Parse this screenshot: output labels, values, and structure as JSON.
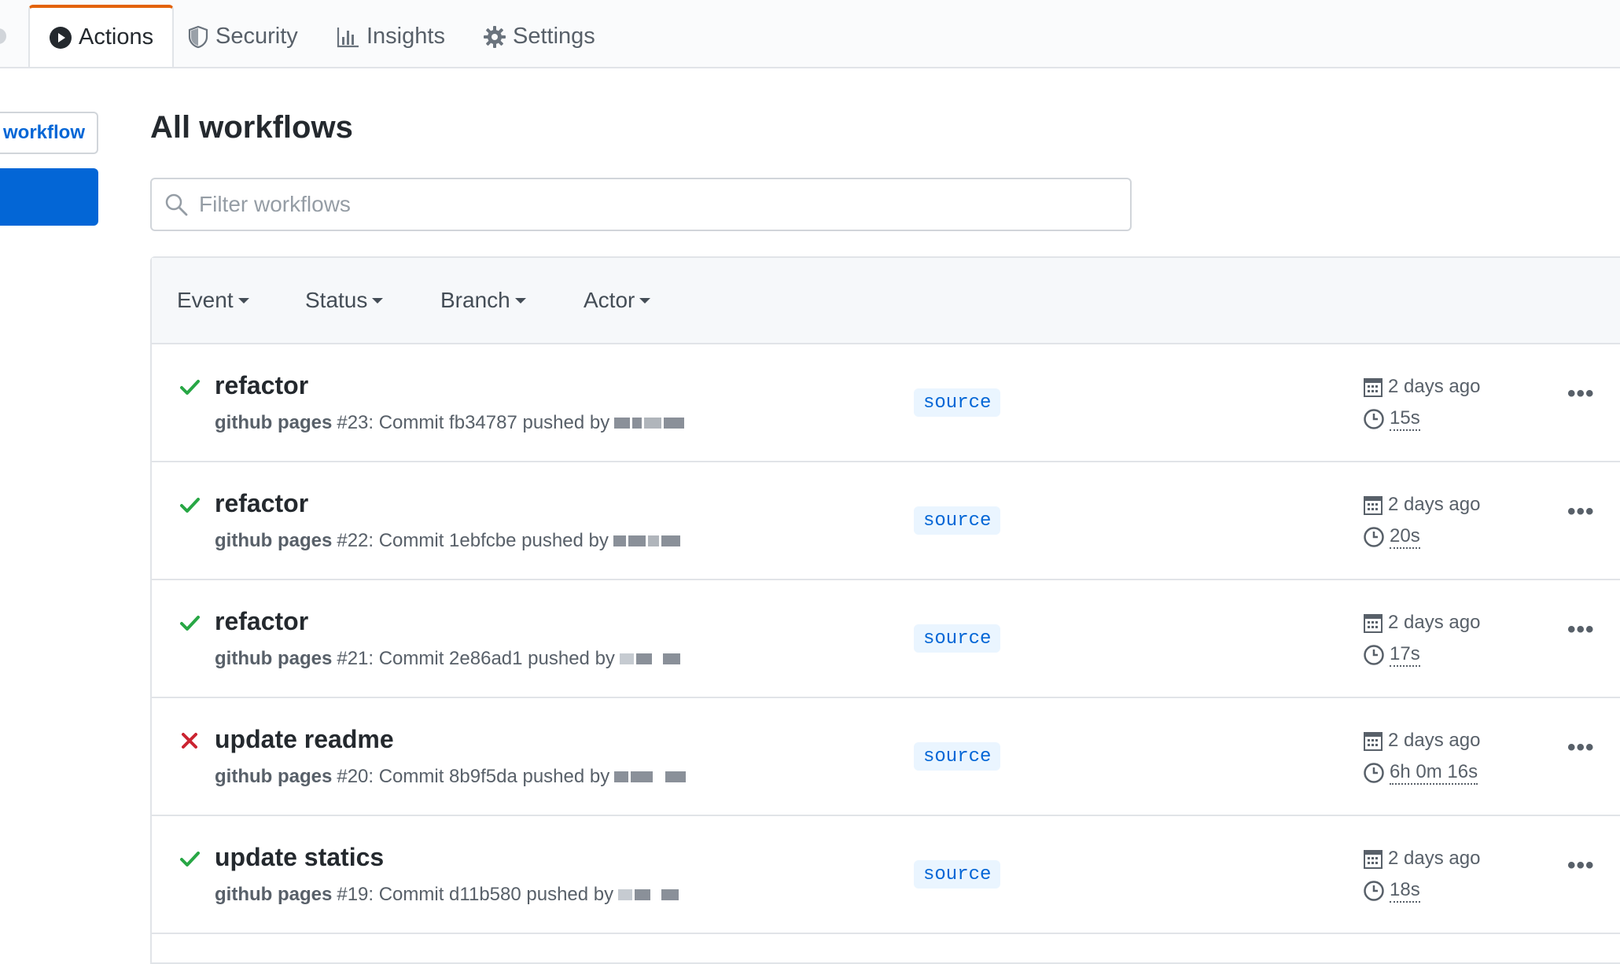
{
  "tabs": [
    {
      "label": "Actions",
      "icon": "play-icon",
      "active": true
    },
    {
      "label": "Security",
      "icon": "shield-icon",
      "active": false
    },
    {
      "label": "Insights",
      "icon": "graph-icon",
      "active": false
    },
    {
      "label": "Settings",
      "icon": "gear-icon",
      "active": false
    }
  ],
  "sidebar": {
    "new_workflow_label": "workflow"
  },
  "main": {
    "title": "All workflows",
    "filter_placeholder": "Filter workflows",
    "filters": [
      "Event",
      "Status",
      "Branch",
      "Actor"
    ]
  },
  "runs": [
    {
      "status": "success",
      "title": "refactor",
      "workflow": "github pages",
      "meta": "#23: Commit fb34787 pushed by",
      "branch": "source",
      "when": "2 days ago",
      "duration": "15s"
    },
    {
      "status": "success",
      "title": "refactor",
      "workflow": "github pages",
      "meta": "#22: Commit 1ebfcbe pushed by",
      "branch": "source",
      "when": "2 days ago",
      "duration": "20s"
    },
    {
      "status": "success",
      "title": "refactor",
      "workflow": "github pages",
      "meta": "#21: Commit 2e86ad1 pushed by",
      "branch": "source",
      "when": "2 days ago",
      "duration": "17s"
    },
    {
      "status": "failure",
      "title": "update readme",
      "workflow": "github pages",
      "meta": "#20: Commit 8b9f5da pushed by",
      "branch": "source",
      "when": "2 days ago",
      "duration": "6h 0m 16s"
    },
    {
      "status": "success",
      "title": "update statics",
      "workflow": "github pages",
      "meta": "#19: Commit d11b580 pushed by",
      "branch": "source",
      "when": "2 days ago",
      "duration": "18s"
    }
  ],
  "colors": {
    "accent": "#0366d6",
    "active_tab_border": "#e36209",
    "success": "#28a745",
    "failure": "#cb2431"
  }
}
